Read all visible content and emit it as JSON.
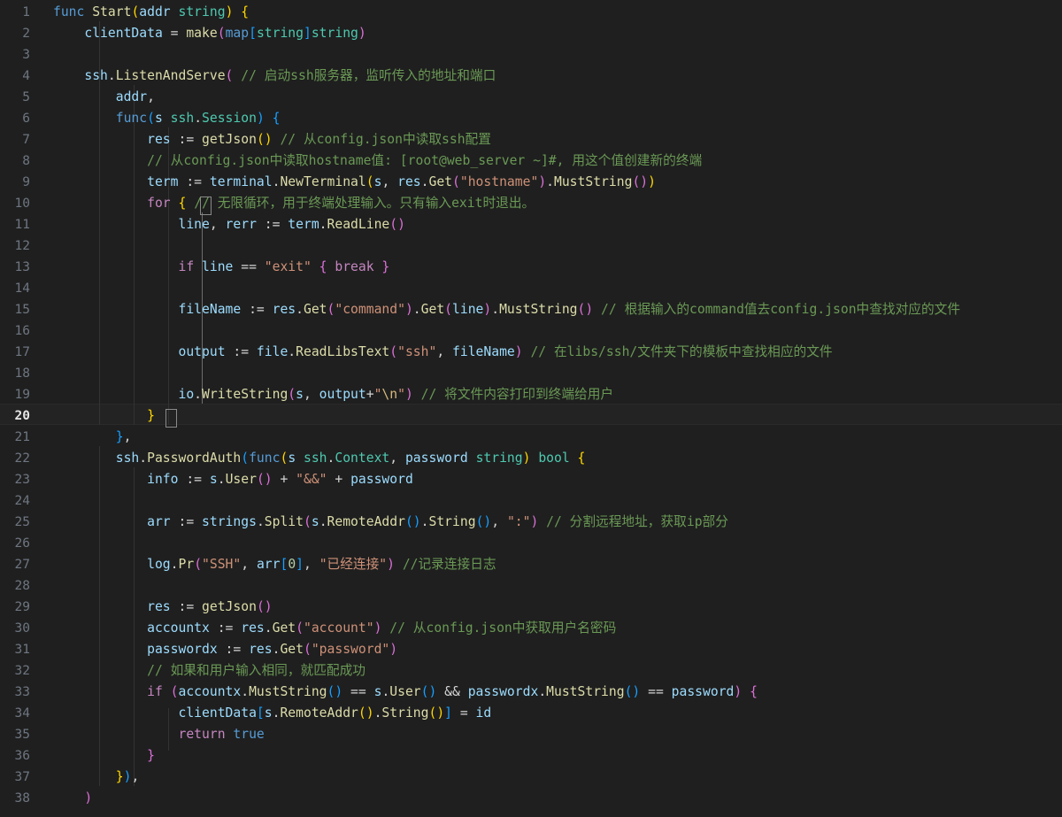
{
  "editor": {
    "name": "code-editor",
    "language": "go",
    "theme": "dark-modern",
    "background": "#1f1f1f",
    "current_line": 20,
    "gutter_color": "#6e7681",
    "active_gutter_color": "#e6e6e6",
    "line_height": 24,
    "font_size": 14.7,
    "first_visible_line": 1,
    "last_visible_line": 38
  },
  "colors": {
    "background": "#1f1f1f",
    "current_line_bg": "#232323",
    "indent_guide": "#333333",
    "indent_guide_active": "#6f6f6f",
    "bracket_match_border": "#8a8a8a",
    "keyword": "#569cd6",
    "control_keyword": "#c586c0",
    "function": "#dcdcaa",
    "type": "#4ec9b0",
    "variable": "#9cdcfe",
    "string": "#ce9178",
    "escape": "#d7ba7d",
    "number": "#b5cea8",
    "comment": "#6a9955",
    "punctuation": "#d4d4d4",
    "bracket_1": "#ffd700",
    "bracket_2": "#da70d6",
    "bracket_3": "#179fff"
  },
  "line_numbers": [
    "1",
    "2",
    "3",
    "4",
    "5",
    "6",
    "7",
    "8",
    "9",
    "10",
    "11",
    "12",
    "13",
    "14",
    "15",
    "16",
    "17",
    "18",
    "19",
    "20",
    "21",
    "22",
    "23",
    "24",
    "25",
    "26",
    "27",
    "28",
    "29",
    "30",
    "31",
    "32",
    "33",
    "34",
    "35",
    "36",
    "37",
    "38"
  ],
  "code_lines": [
    {
      "n": 1,
      "text": "func Start(addr string) {"
    },
    {
      "n": 2,
      "text": "    clientData = make(map[string]string)"
    },
    {
      "n": 3,
      "text": ""
    },
    {
      "n": 4,
      "text": "    ssh.ListenAndServe( // 启动ssh服务器，监听传入的地址和端口"
    },
    {
      "n": 5,
      "text": "        addr,"
    },
    {
      "n": 6,
      "text": "        func(s ssh.Session) {"
    },
    {
      "n": 7,
      "text": "            res := getJson() // 从config.json中读取ssh配置"
    },
    {
      "n": 8,
      "text": "            // 从config.json中读取hostname值: [root@web_server ~]#, 用这个值创建新的终端"
    },
    {
      "n": 9,
      "text": "            term := terminal.NewTerminal(s, res.Get(\"hostname\").MustString())"
    },
    {
      "n": 10,
      "text": "            for { // 无限循环，用于终端处理输入。只有输入exit时退出。"
    },
    {
      "n": 11,
      "text": "                line, rerr := term.ReadLine()"
    },
    {
      "n": 12,
      "text": ""
    },
    {
      "n": 13,
      "text": "                if line == \"exit\" { break }"
    },
    {
      "n": 14,
      "text": ""
    },
    {
      "n": 15,
      "text": "                fileName := res.Get(\"command\").Get(line).MustString() // 根据输入的command值去config.json中查找对应的文件"
    },
    {
      "n": 16,
      "text": ""
    },
    {
      "n": 17,
      "text": "                output := file.ReadLibsText(\"ssh\", fileName) // 在libs/ssh/文件夹下的模板中查找相应的文件"
    },
    {
      "n": 18,
      "text": ""
    },
    {
      "n": 19,
      "text": "                io.WriteString(s, output+\"\\n\") // 将文件内容打印到终端给用户"
    },
    {
      "n": 20,
      "text": "            }"
    },
    {
      "n": 21,
      "text": "        },"
    },
    {
      "n": 22,
      "text": "        ssh.PasswordAuth(func(s ssh.Context, password string) bool {"
    },
    {
      "n": 23,
      "text": "            info := s.User() + \"&&\" + password"
    },
    {
      "n": 24,
      "text": ""
    },
    {
      "n": 25,
      "text": "            arr := strings.Split(s.RemoteAddr().String(), \":\") // 分割远程地址，获取ip部分"
    },
    {
      "n": 26,
      "text": ""
    },
    {
      "n": 27,
      "text": "            log.Pr(\"SSH\", arr[0], \"已经连接\") //记录连接日志"
    },
    {
      "n": 28,
      "text": ""
    },
    {
      "n": 29,
      "text": "            res := getJson()"
    },
    {
      "n": 30,
      "text": "            accountx := res.Get(\"account\") // 从config.json中获取用户名密码"
    },
    {
      "n": 31,
      "text": "            passwordx := res.Get(\"password\")"
    },
    {
      "n": 32,
      "text": "            // 如果和用户输入相同，就匹配成功"
    },
    {
      "n": 33,
      "text": "            if (accountx.MustString() == s.User() && passwordx.MustString() == password) {"
    },
    {
      "n": 34,
      "text": "                clientData[s.RemoteAddr().String()] = id"
    },
    {
      "n": 35,
      "text": "                return true"
    },
    {
      "n": 36,
      "text": "            }"
    },
    {
      "n": 37,
      "text": "        }),"
    },
    {
      "n": 38,
      "text": "    )"
    }
  ],
  "comments": {
    "line4": "// 启动ssh服务器，监听传入的地址和端口",
    "line7": "// 从config.json中读取ssh配置",
    "line8": "// 从config.json中读取hostname值: [root@web_server ~]#, 用这个值创建新的终端",
    "line10": "// 无限循环，用于终端处理输入。只有输入exit时退出。",
    "line15": "// 根据输入的command值去config.json中查找对应的文件",
    "line17": "// 在libs/ssh/文件夹下的模板中查找相应的文件",
    "line19": "// 将文件内容打印到终端给用户",
    "line25": "// 分割远程地址，获取ip部分",
    "line27": "//记录连接日志",
    "line30": "// 从config.json中获取用户名密码",
    "line32": "// 如果和用户输入相同，就匹配成功"
  },
  "bracket_match": {
    "open_line": 10,
    "open_char": "{",
    "close_line": 20,
    "close_char": "}"
  }
}
